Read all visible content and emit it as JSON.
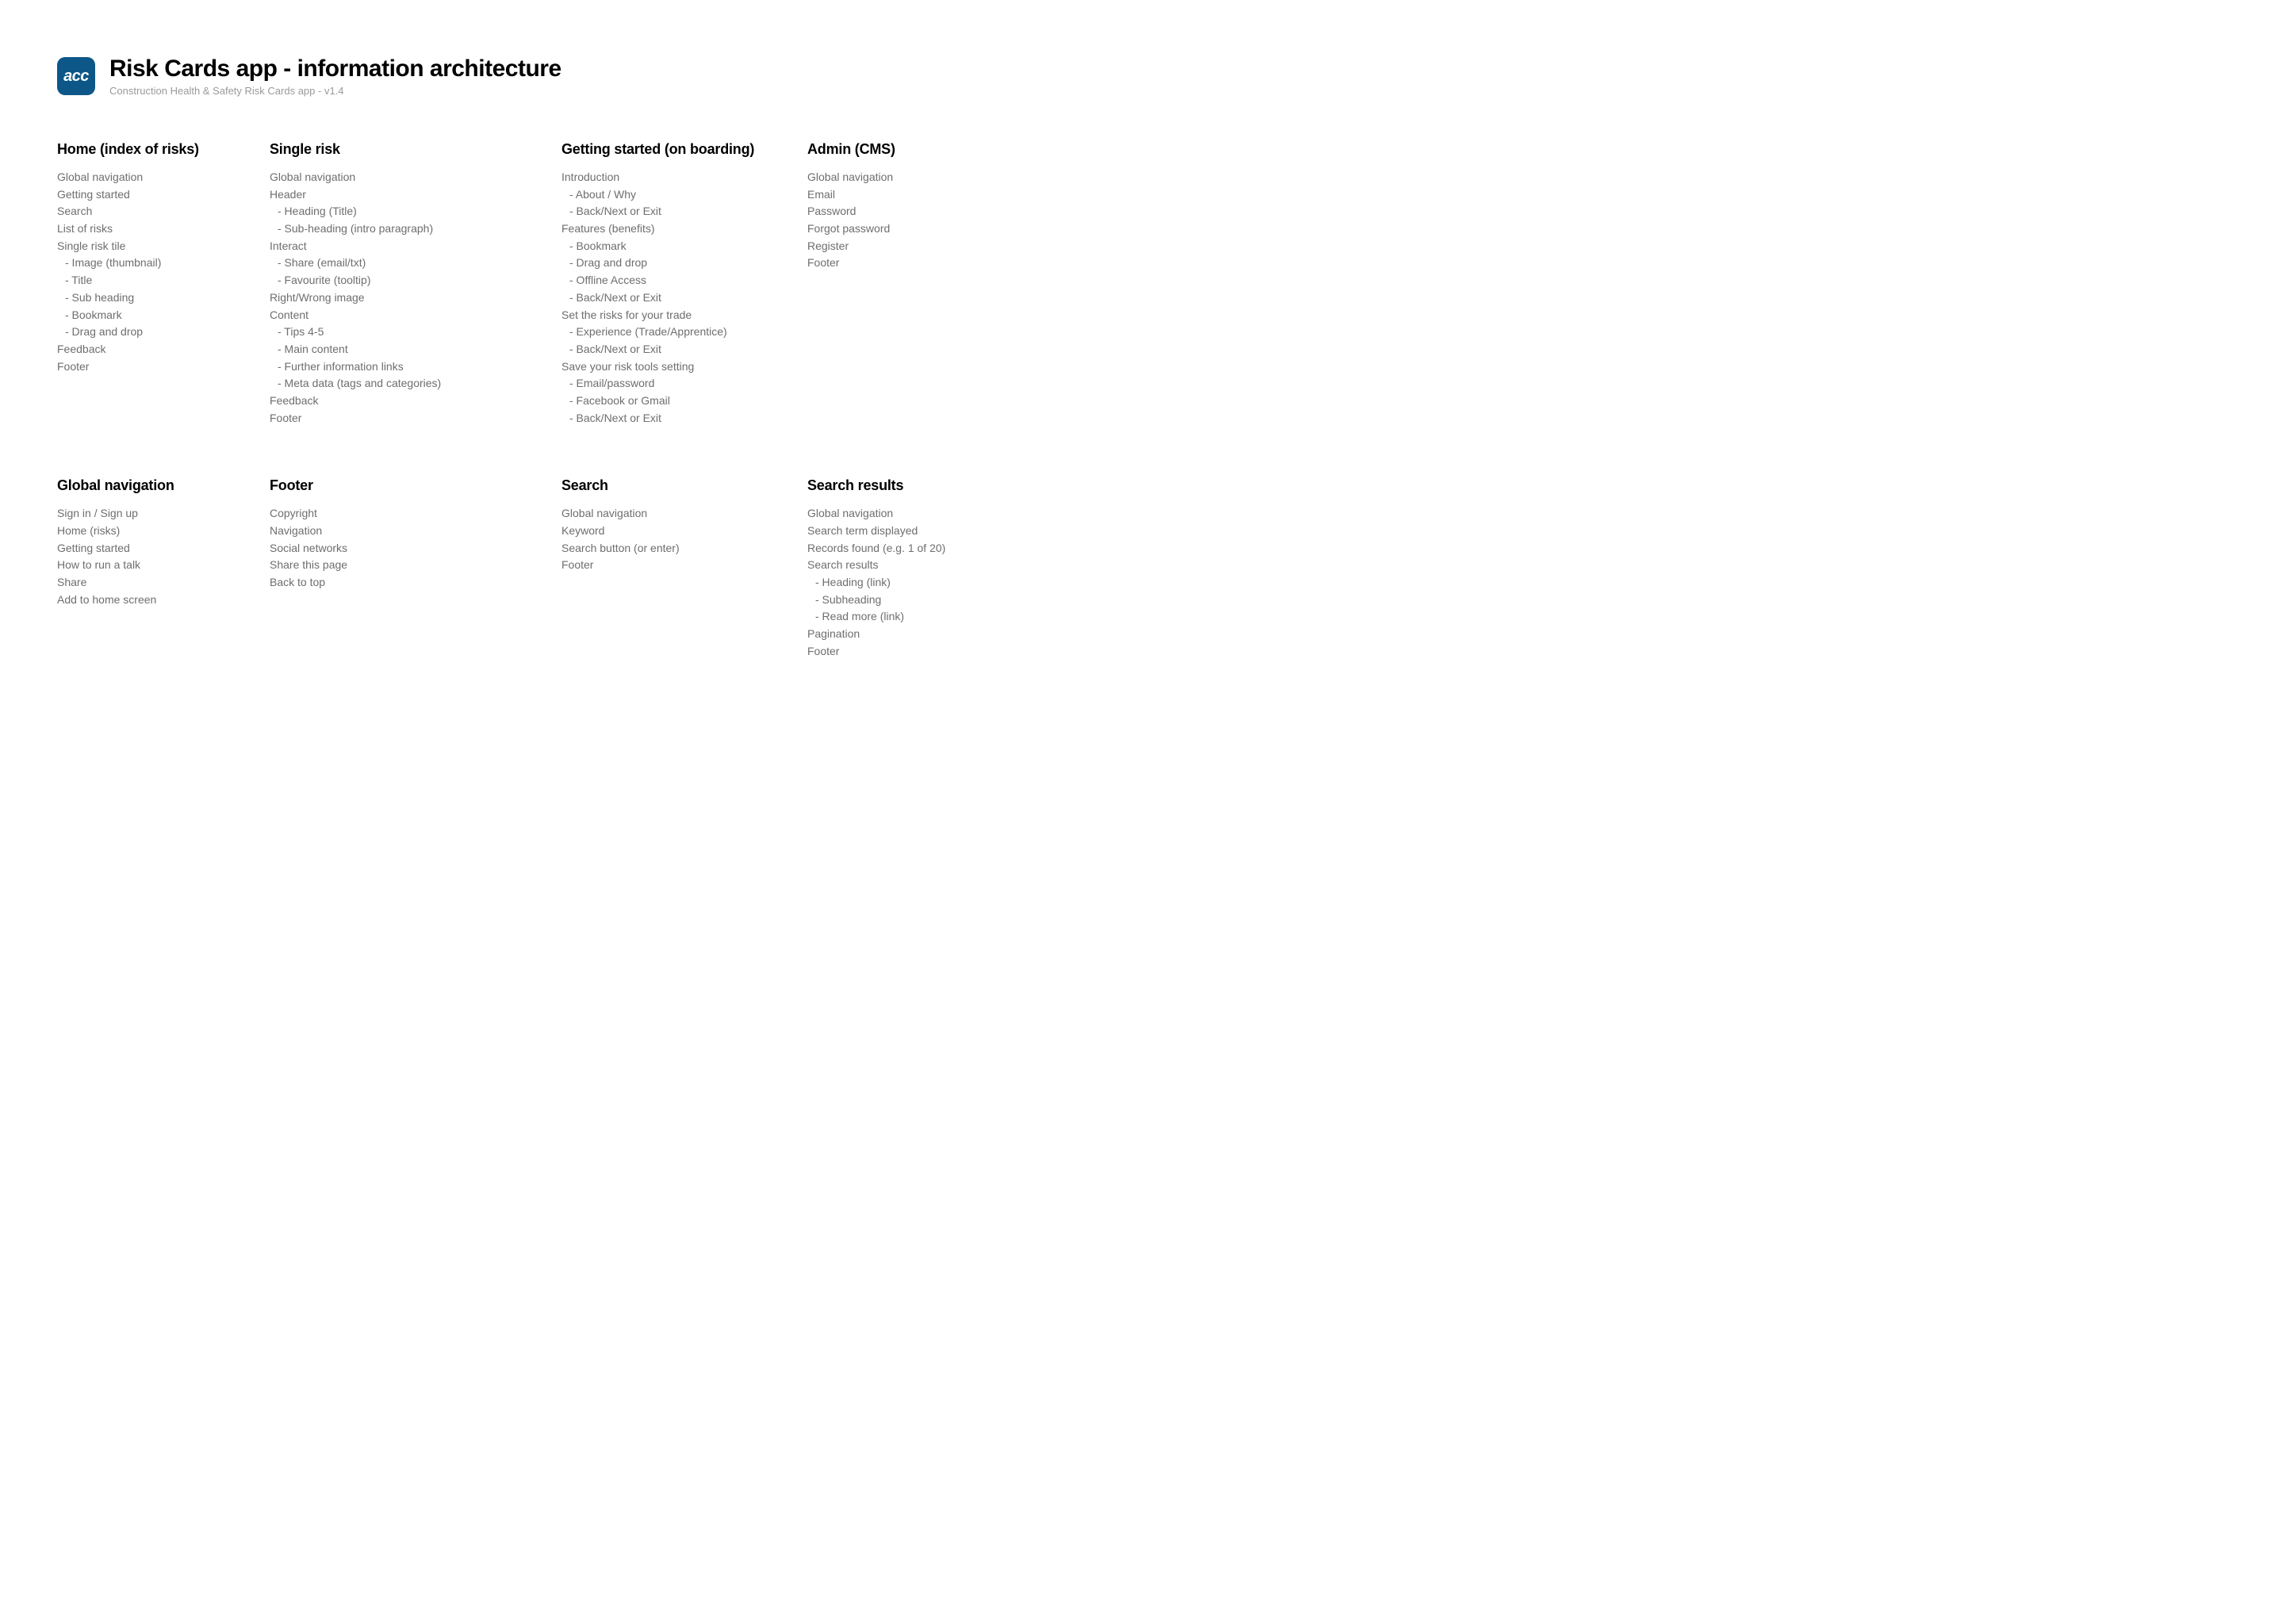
{
  "header": {
    "logo_text": "acc",
    "title": "Risk Cards app - information architecture",
    "subtitle": "Construction Health & Safety Risk Cards app - v1.4"
  },
  "sections": [
    {
      "title": "Home (index of risks)",
      "items": [
        {
          "text": "Global navigation",
          "indent": 0
        },
        {
          "text": "Getting started",
          "indent": 0
        },
        {
          "text": "Search",
          "indent": 0
        },
        {
          "text": "List of risks",
          "indent": 0
        },
        {
          "text": "Single risk tile",
          "indent": 0
        },
        {
          "text": "- Image (thumbnail)",
          "indent": 1
        },
        {
          "text": "- Title",
          "indent": 1
        },
        {
          "text": "- Sub heading",
          "indent": 1
        },
        {
          "text": "- Bookmark",
          "indent": 1
        },
        {
          "text": "- Drag and drop",
          "indent": 1
        },
        {
          "text": "Feedback",
          "indent": 0
        },
        {
          "text": "Footer",
          "indent": 0
        }
      ]
    },
    {
      "title": "Single risk",
      "items": [
        {
          "text": "Global navigation",
          "indent": 0
        },
        {
          "text": "Header",
          "indent": 0
        },
        {
          "text": "- Heading (Title)",
          "indent": 1
        },
        {
          "text": "- Sub-heading (intro paragraph)",
          "indent": 1
        },
        {
          "text": "Interact",
          "indent": 0
        },
        {
          "text": "- Share (email/txt)",
          "indent": 1
        },
        {
          "text": "- Favourite (tooltip)",
          "indent": 1
        },
        {
          "text": "Right/Wrong image",
          "indent": 0
        },
        {
          "text": "Content",
          "indent": 0
        },
        {
          "text": "- Tips 4-5",
          "indent": 1
        },
        {
          "text": "- Main content",
          "indent": 1
        },
        {
          "text": "- Further information links",
          "indent": 1
        },
        {
          "text": "- Meta data (tags and categories)",
          "indent": 1
        },
        {
          "text": "Feedback",
          "indent": 0
        },
        {
          "text": "Footer",
          "indent": 0
        }
      ]
    },
    {
      "title": "Getting started (on boarding)",
      "items": [
        {
          "text": "Introduction",
          "indent": 0
        },
        {
          "text": "- About / Why",
          "indent": 1
        },
        {
          "text": "- Back/Next or Exit",
          "indent": 1
        },
        {
          "text": "Features (benefits)",
          "indent": 0
        },
        {
          "text": "- Bookmark",
          "indent": 1
        },
        {
          "text": "- Drag and drop",
          "indent": 1
        },
        {
          "text": "- Offline Access",
          "indent": 1
        },
        {
          "text": "- Back/Next or Exit",
          "indent": 1
        },
        {
          "text": "Set the risks for your trade",
          "indent": 0
        },
        {
          "text": "- Experience (Trade/Apprentice)",
          "indent": 1
        },
        {
          "text": "- Back/Next or Exit",
          "indent": 1
        },
        {
          "text": "Save your risk tools setting",
          "indent": 0
        },
        {
          "text": "- Email/password",
          "indent": 1
        },
        {
          "text": "- Facebook or Gmail",
          "indent": 1
        },
        {
          "text": "- Back/Next or Exit",
          "indent": 1
        }
      ]
    },
    {
      "title": "Admin (CMS)",
      "items": [
        {
          "text": "Global navigation",
          "indent": 0
        },
        {
          "text": "Email",
          "indent": 0
        },
        {
          "text": "Password",
          "indent": 0
        },
        {
          "text": "Forgot password",
          "indent": 0
        },
        {
          "text": "Register",
          "indent": 0
        },
        {
          "text": "Footer",
          "indent": 0
        }
      ]
    },
    {
      "title": "Global navigation",
      "items": [
        {
          "text": "Sign in / Sign up",
          "indent": 0
        },
        {
          "text": "Home (risks)",
          "indent": 0
        },
        {
          "text": "Getting started",
          "indent": 0
        },
        {
          "text": "How to run a talk",
          "indent": 0
        },
        {
          "text": "Share",
          "indent": 0
        },
        {
          "text": "Add to home screen",
          "indent": 0
        }
      ]
    },
    {
      "title": "Footer",
      "items": [
        {
          "text": "Copyright",
          "indent": 0
        },
        {
          "text": "Navigation",
          "indent": 0
        },
        {
          "text": "Social networks",
          "indent": 0
        },
        {
          "text": "Share this page",
          "indent": 0
        },
        {
          "text": "Back to top",
          "indent": 0
        }
      ]
    },
    {
      "title": "Search",
      "items": [
        {
          "text": "Global navigation",
          "indent": 0
        },
        {
          "text": "Keyword",
          "indent": 0
        },
        {
          "text": "Search button (or enter)",
          "indent": 0
        },
        {
          "text": "Footer",
          "indent": 0
        }
      ]
    },
    {
      "title": "Search results",
      "items": [
        {
          "text": "Global navigation",
          "indent": 0
        },
        {
          "text": "Search term displayed",
          "indent": 0
        },
        {
          "text": "Records found (e.g. 1 of 20)",
          "indent": 0
        },
        {
          "text": "Search results",
          "indent": 0
        },
        {
          "text": "- Heading (link)",
          "indent": 1
        },
        {
          "text": "- Subheading",
          "indent": 1
        },
        {
          "text": "- Read more (link)",
          "indent": 1
        },
        {
          "text": "Pagination",
          "indent": 0
        },
        {
          "text": "Footer",
          "indent": 0
        }
      ]
    }
  ]
}
